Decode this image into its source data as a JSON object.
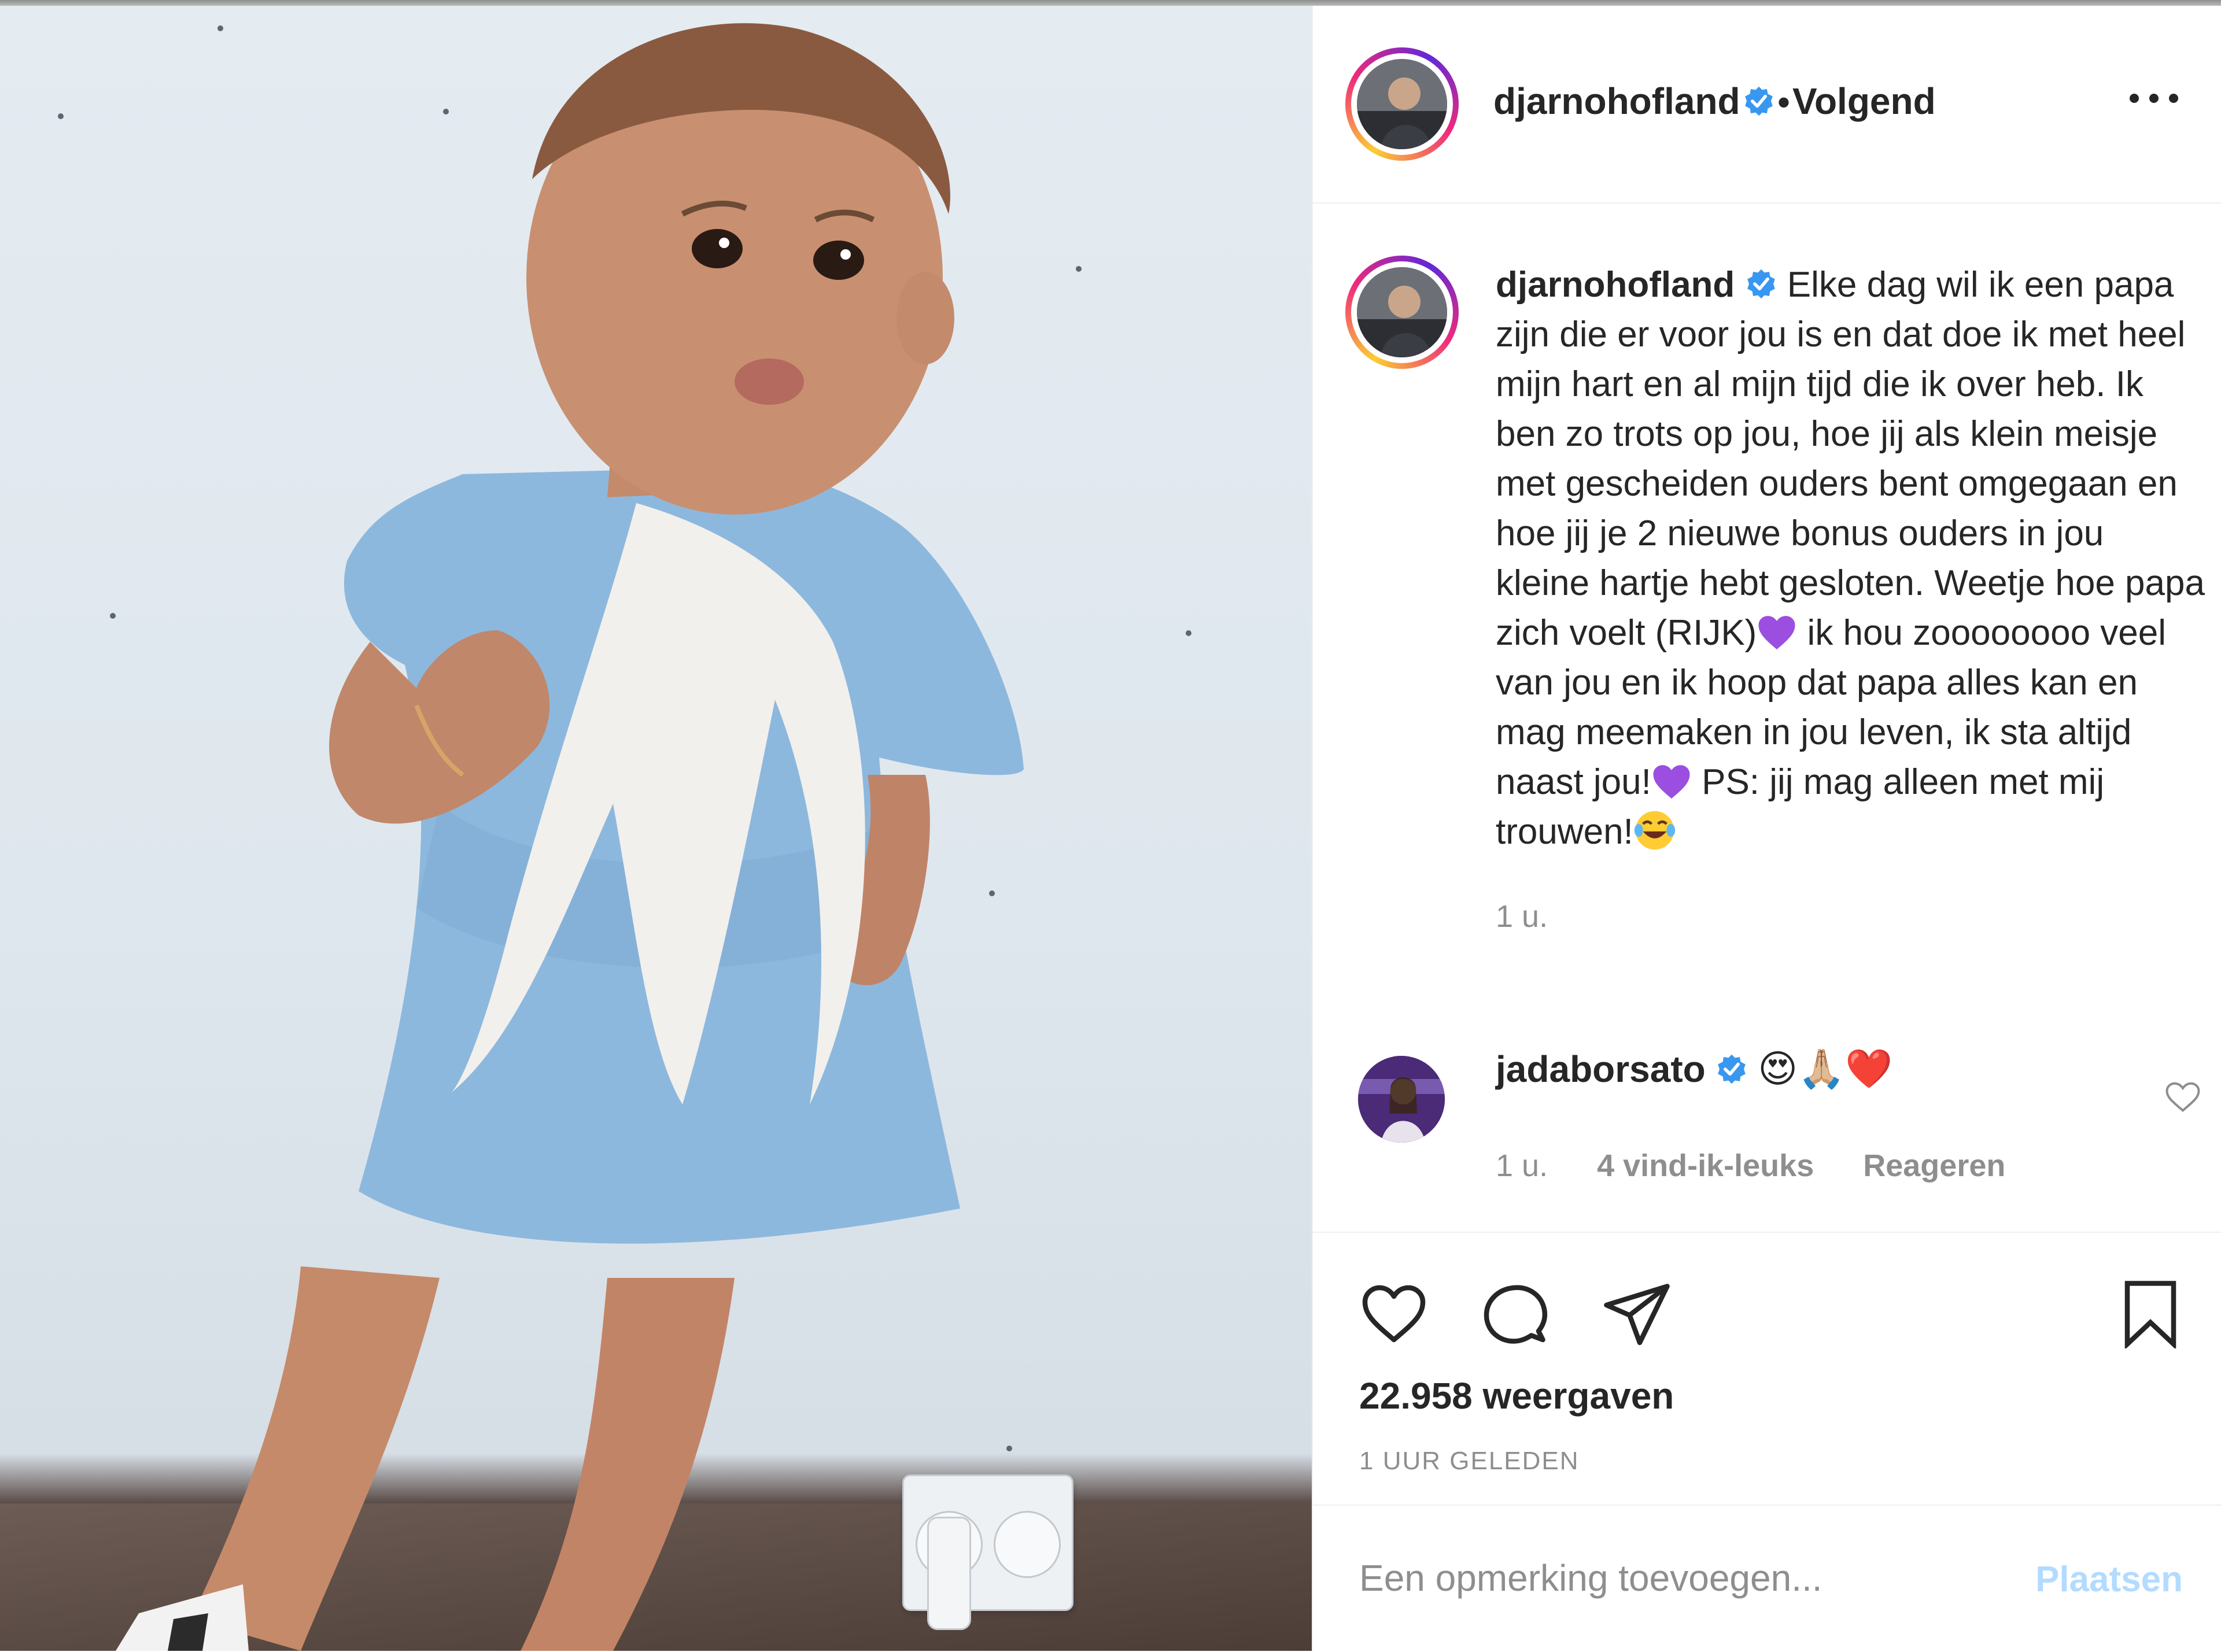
{
  "post": {
    "author": "djarnohofland",
    "follow_state": "Volgend",
    "separator": "•",
    "caption_text": "Elke dag wil ik een papa zijn die er voor jou is en dat doe ik met heel mijn hart en al mijn tijd die ik over heb. Ik ben zo trots op jou, hoe jij als klein meisje met gescheiden ouders bent omgegaan en hoe jij je 2 nieuwe bonus ouders in jou kleine hartje hebt gesloten. Weetje hoe papa zich voelt (RIJK)",
    "caption_text_2": " ik hou zoooooooo veel van jou en ik hoop dat papa alles kan en mag meemaken in jou leven, ik sta altijd naast jou!",
    "caption_text_3": " PS: jij mag alleen met mij trouwen!",
    "caption_time": "1 u.",
    "views_count": "22.958",
    "views_label": "weergaven",
    "posted_ago": "1 UUR GELEDEN"
  },
  "comments": [
    {
      "author": "jadaborsato",
      "text": "😍🙏🏼❤️",
      "time": "1 u.",
      "likes": "4 vind-ik-leuks",
      "reply": "Reageren"
    }
  ],
  "composer": {
    "placeholder": "Een opmerking toevoegen...",
    "post_label": "Plaatsen"
  },
  "icons": {
    "verified": "verified-badge-icon",
    "more": "more-options-icon",
    "like": "heart-icon",
    "comment": "comment-bubble-icon",
    "share": "paper-plane-icon",
    "save": "bookmark-icon"
  },
  "colors": {
    "text": "#262626",
    "secondary": "#8e8e8e",
    "verified": "#3897f0",
    "post_button_disabled": "#b3dbff",
    "purple_heart": "#9b4ee0"
  }
}
